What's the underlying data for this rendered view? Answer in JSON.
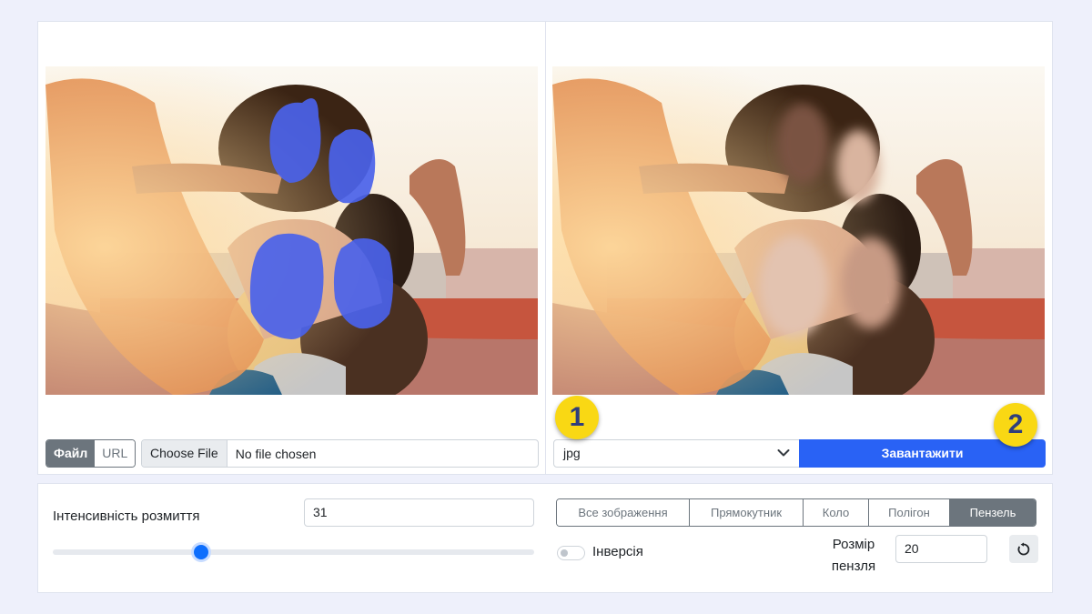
{
  "upload": {
    "source_tabs": [
      {
        "label": "Файл",
        "active": true
      },
      {
        "label": "URL",
        "active": false
      }
    ],
    "choose_file_label": "Choose File",
    "no_file_label": "No file chosen"
  },
  "output": {
    "format_value": "jpg",
    "download_label": "Завантажити"
  },
  "badges": [
    "1",
    "2"
  ],
  "blur": {
    "intensity_label": "Інтенсивність розмиття",
    "intensity_value": "31",
    "slider_fraction": 0.31
  },
  "modes": [
    {
      "label": "Все зображення",
      "active": false
    },
    {
      "label": "Прямокутник",
      "active": false
    },
    {
      "label": "Коло",
      "active": false
    },
    {
      "label": "Полігон",
      "active": false
    },
    {
      "label": "Пензель",
      "active": true
    }
  ],
  "inversion_label": "Інверсія",
  "brush": {
    "size_label_line1": "Розмір",
    "size_label_line2": "пензля",
    "size_value": "20"
  },
  "icons": {
    "chevron": "chevron-down-icon",
    "reset": "reset-icon"
  },
  "colors": {
    "accent": "#2962f5",
    "badge": "#f9d814",
    "mask": "#4a62ea"
  }
}
